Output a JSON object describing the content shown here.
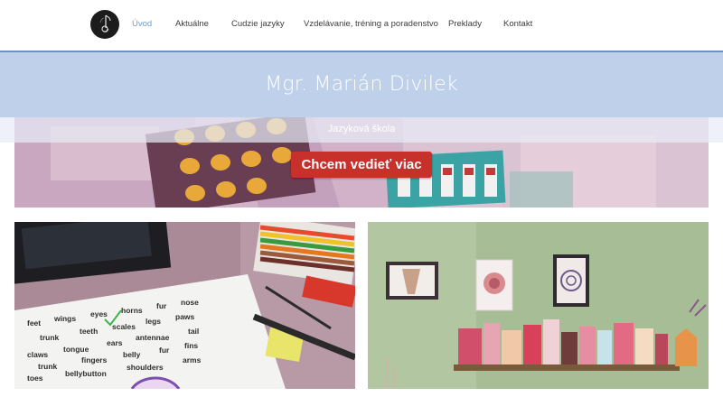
{
  "nav": {
    "items": [
      {
        "label": "Úvod",
        "active": true
      },
      {
        "label": "Aktuálne",
        "active": false
      },
      {
        "label": "Cudzie jazyky",
        "active": false
      },
      {
        "label": "Vzdelávanie, tréning a poradenstvo",
        "active": false
      },
      {
        "label": "Preklady",
        "active": false
      },
      {
        "label": "Kontakt",
        "active": false
      }
    ]
  },
  "hero": {
    "title": "Mgr. Marián Divilek",
    "subtitle": "Jazyková škola",
    "cta_label": "Chcem vedieť viac"
  },
  "cards": {
    "left": {
      "words": [
        "feet",
        "wings",
        "eyes",
        "horns",
        "fur",
        "nose",
        "trunk",
        "teeth",
        "scales",
        "legs",
        "paws",
        "claws",
        "tongue",
        "ears",
        "antennae",
        "tail",
        "trunk",
        "fingers",
        "belly",
        "fur",
        "fins",
        "toes",
        "bellybutton",
        "shoulders",
        "arms"
      ]
    },
    "right": {}
  },
  "colors": {
    "accent": "#6f9fd0",
    "nav_text": "#3c3c3c",
    "hero_band": "#bfd0ea",
    "header_line": "#6d8fc4",
    "cta": "#c8302c"
  }
}
